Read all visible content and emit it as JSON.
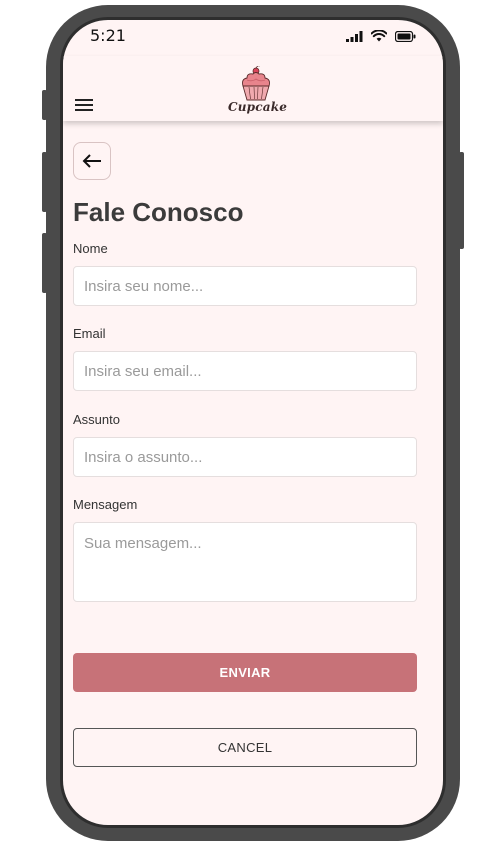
{
  "status_bar": {
    "time": "5:21"
  },
  "header": {
    "logo_text": "Cupcake",
    "brand_color": "#c77278"
  },
  "page": {
    "title": "Fale Conosco",
    "back_icon": "arrow-left-icon"
  },
  "form": {
    "fields": [
      {
        "label": "Nome",
        "placeholder": "Insira seu nome...",
        "value": ""
      },
      {
        "label": "Email",
        "placeholder": "Insira seu email...",
        "value": ""
      },
      {
        "label": "Assunto",
        "placeholder": "Insira o assunto...",
        "value": ""
      },
      {
        "label": "Mensagem",
        "placeholder": "Sua mensagem...",
        "value": ""
      }
    ],
    "submit_label": "ENVIAR",
    "cancel_label": "CANCEL"
  },
  "colors": {
    "background": "#fff4f4",
    "submit_button": "#c77278",
    "title_text": "#3b3b3b"
  }
}
